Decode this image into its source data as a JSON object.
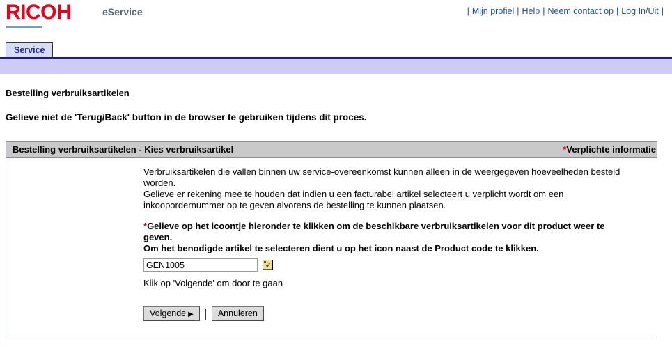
{
  "header": {
    "logo_text": "RICOH",
    "app_name": "eService",
    "nav_links": [
      {
        "label": "Mijn profiel"
      },
      {
        "label": "Help"
      },
      {
        "label": "Neem contact op"
      },
      {
        "label": "Log In/Uit"
      }
    ],
    "separator": "|"
  },
  "tabs": {
    "items": [
      {
        "label": "Service",
        "active": true
      }
    ]
  },
  "page": {
    "title": "Bestelling verbruiksartikelen",
    "warning": "Gelieve niet de 'Terug/Back' button in de browser te gebruiken tijdens dit proces."
  },
  "panel": {
    "title": "Bestelling verbruiksartikelen - Kies verbruiksartikel",
    "required_star": "*",
    "required_label": "Verplichte informatie",
    "paragraph_1": "Verbruiksartikelen die vallen binnen uw service-overeenkomst kunnen alleen in de weergegeven hoeveelheden besteld worden.",
    "paragraph_2": "Gelieve er rekening mee te houden dat indien u een facturabel artikel selecteert u verplicht wordt om een inkoopordernummer op te geven alvorens de bestelling te kunnen plaatsen.",
    "instruction_star": "*",
    "instruction_line_1": "Gelieve op het icoontje hieronder te klikken om de beschikbare verbruiksartikelen voor dit product weer te geven.",
    "instruction_line_2": "Om het benodigde artikel te selecteren dient u op het icon naast de Product code te klikken.",
    "product_code_value": "GEN1005",
    "product_code_placeholder": "",
    "picker_icon_name": "product-lookup-icon",
    "hint": "Klik op 'Volgende' om door te gaan",
    "buttons": {
      "next_label": "Volgende",
      "next_arrow": "▶",
      "cancel_label": "Annuleren"
    }
  },
  "colors": {
    "brand_red": "#e8001c",
    "link_blue": "#1a4f9c",
    "tab_navy": "#24249a",
    "subbar_lavender": "#ccccf7",
    "panel_head_gray": "#c9c9c9",
    "required_red": "#d00000"
  }
}
